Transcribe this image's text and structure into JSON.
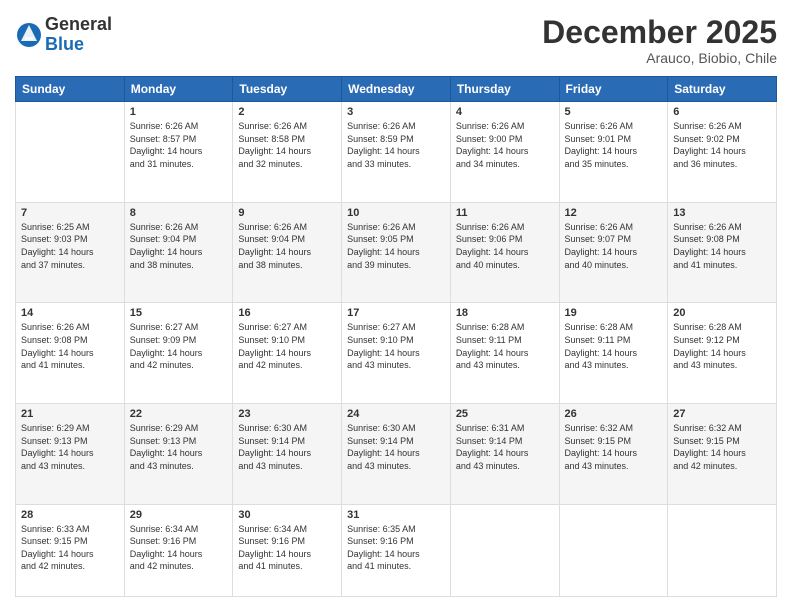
{
  "header": {
    "logo_general": "General",
    "logo_blue": "Blue",
    "month_title": "December 2025",
    "subtitle": "Arauco, Biobio, Chile"
  },
  "weekdays": [
    "Sunday",
    "Monday",
    "Tuesday",
    "Wednesday",
    "Thursday",
    "Friday",
    "Saturday"
  ],
  "weeks": [
    [
      {
        "day": "",
        "info": ""
      },
      {
        "day": "1",
        "info": "Sunrise: 6:26 AM\nSunset: 8:57 PM\nDaylight: 14 hours\nand 31 minutes."
      },
      {
        "day": "2",
        "info": "Sunrise: 6:26 AM\nSunset: 8:58 PM\nDaylight: 14 hours\nand 32 minutes."
      },
      {
        "day": "3",
        "info": "Sunrise: 6:26 AM\nSunset: 8:59 PM\nDaylight: 14 hours\nand 33 minutes."
      },
      {
        "day": "4",
        "info": "Sunrise: 6:26 AM\nSunset: 9:00 PM\nDaylight: 14 hours\nand 34 minutes."
      },
      {
        "day": "5",
        "info": "Sunrise: 6:26 AM\nSunset: 9:01 PM\nDaylight: 14 hours\nand 35 minutes."
      },
      {
        "day": "6",
        "info": "Sunrise: 6:26 AM\nSunset: 9:02 PM\nDaylight: 14 hours\nand 36 minutes."
      }
    ],
    [
      {
        "day": "7",
        "info": "Sunrise: 6:25 AM\nSunset: 9:03 PM\nDaylight: 14 hours\nand 37 minutes."
      },
      {
        "day": "8",
        "info": "Sunrise: 6:26 AM\nSunset: 9:04 PM\nDaylight: 14 hours\nand 38 minutes."
      },
      {
        "day": "9",
        "info": "Sunrise: 6:26 AM\nSunset: 9:04 PM\nDaylight: 14 hours\nand 38 minutes."
      },
      {
        "day": "10",
        "info": "Sunrise: 6:26 AM\nSunset: 9:05 PM\nDaylight: 14 hours\nand 39 minutes."
      },
      {
        "day": "11",
        "info": "Sunrise: 6:26 AM\nSunset: 9:06 PM\nDaylight: 14 hours\nand 40 minutes."
      },
      {
        "day": "12",
        "info": "Sunrise: 6:26 AM\nSunset: 9:07 PM\nDaylight: 14 hours\nand 40 minutes."
      },
      {
        "day": "13",
        "info": "Sunrise: 6:26 AM\nSunset: 9:08 PM\nDaylight: 14 hours\nand 41 minutes."
      }
    ],
    [
      {
        "day": "14",
        "info": "Sunrise: 6:26 AM\nSunset: 9:08 PM\nDaylight: 14 hours\nand 41 minutes."
      },
      {
        "day": "15",
        "info": "Sunrise: 6:27 AM\nSunset: 9:09 PM\nDaylight: 14 hours\nand 42 minutes."
      },
      {
        "day": "16",
        "info": "Sunrise: 6:27 AM\nSunset: 9:10 PM\nDaylight: 14 hours\nand 42 minutes."
      },
      {
        "day": "17",
        "info": "Sunrise: 6:27 AM\nSunset: 9:10 PM\nDaylight: 14 hours\nand 43 minutes."
      },
      {
        "day": "18",
        "info": "Sunrise: 6:28 AM\nSunset: 9:11 PM\nDaylight: 14 hours\nand 43 minutes."
      },
      {
        "day": "19",
        "info": "Sunrise: 6:28 AM\nSunset: 9:11 PM\nDaylight: 14 hours\nand 43 minutes."
      },
      {
        "day": "20",
        "info": "Sunrise: 6:28 AM\nSunset: 9:12 PM\nDaylight: 14 hours\nand 43 minutes."
      }
    ],
    [
      {
        "day": "21",
        "info": "Sunrise: 6:29 AM\nSunset: 9:13 PM\nDaylight: 14 hours\nand 43 minutes."
      },
      {
        "day": "22",
        "info": "Sunrise: 6:29 AM\nSunset: 9:13 PM\nDaylight: 14 hours\nand 43 minutes."
      },
      {
        "day": "23",
        "info": "Sunrise: 6:30 AM\nSunset: 9:14 PM\nDaylight: 14 hours\nand 43 minutes."
      },
      {
        "day": "24",
        "info": "Sunrise: 6:30 AM\nSunset: 9:14 PM\nDaylight: 14 hours\nand 43 minutes."
      },
      {
        "day": "25",
        "info": "Sunrise: 6:31 AM\nSunset: 9:14 PM\nDaylight: 14 hours\nand 43 minutes."
      },
      {
        "day": "26",
        "info": "Sunrise: 6:32 AM\nSunset: 9:15 PM\nDaylight: 14 hours\nand 43 minutes."
      },
      {
        "day": "27",
        "info": "Sunrise: 6:32 AM\nSunset: 9:15 PM\nDaylight: 14 hours\nand 42 minutes."
      }
    ],
    [
      {
        "day": "28",
        "info": "Sunrise: 6:33 AM\nSunset: 9:15 PM\nDaylight: 14 hours\nand 42 minutes."
      },
      {
        "day": "29",
        "info": "Sunrise: 6:34 AM\nSunset: 9:16 PM\nDaylight: 14 hours\nand 42 minutes."
      },
      {
        "day": "30",
        "info": "Sunrise: 6:34 AM\nSunset: 9:16 PM\nDaylight: 14 hours\nand 41 minutes."
      },
      {
        "day": "31",
        "info": "Sunrise: 6:35 AM\nSunset: 9:16 PM\nDaylight: 14 hours\nand 41 minutes."
      },
      {
        "day": "",
        "info": ""
      },
      {
        "day": "",
        "info": ""
      },
      {
        "day": "",
        "info": ""
      }
    ]
  ]
}
